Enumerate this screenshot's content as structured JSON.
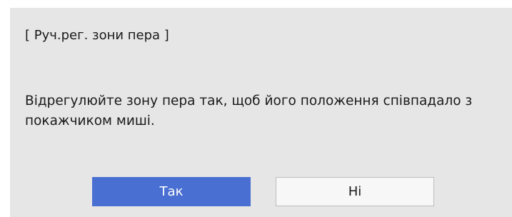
{
  "dialog": {
    "title": "[ Руч.рег. зони пера ]",
    "message": "Відрегулюйте зону пера так, щоб його положення співпадало з покажчиком миші.",
    "buttons": {
      "yes_label": "Так",
      "no_label": "Ні"
    },
    "colors": {
      "background": "#e6e6e6",
      "primary_button": "#4a6fd2",
      "secondary_button": "#f7f7f7"
    }
  }
}
